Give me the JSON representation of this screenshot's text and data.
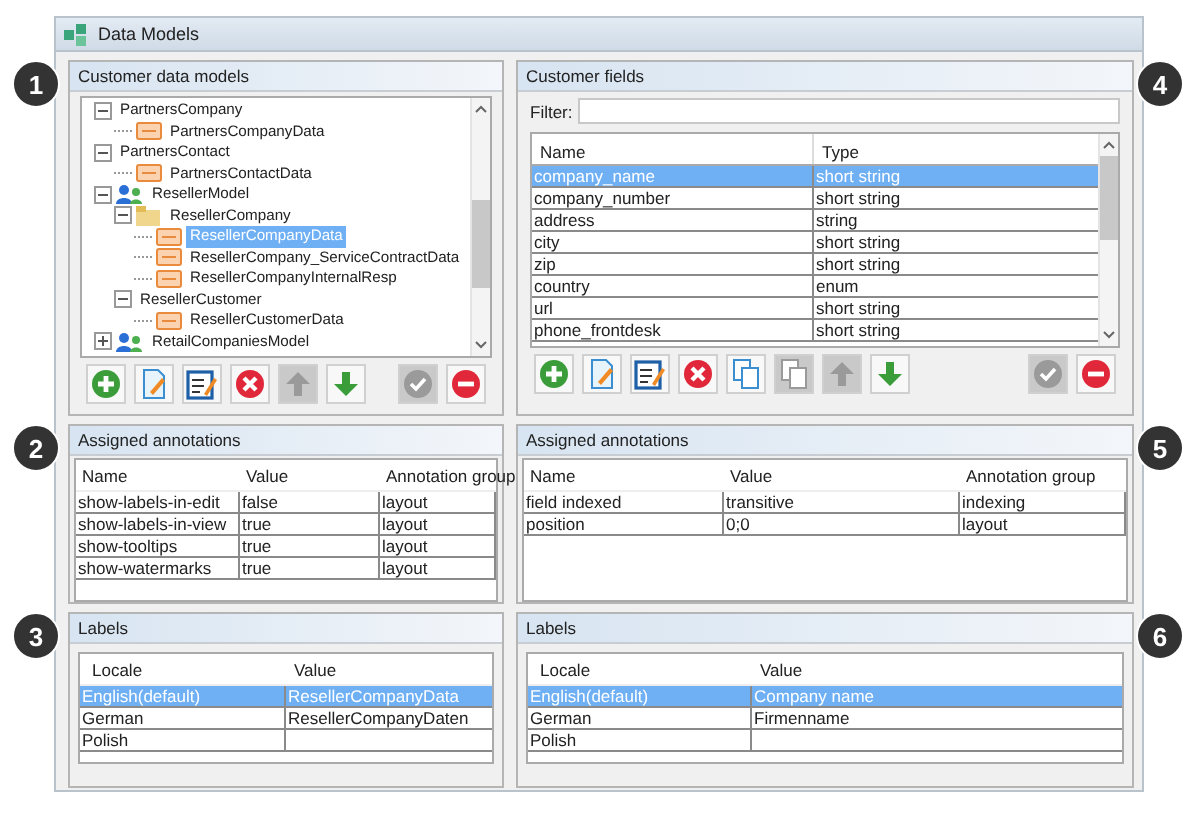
{
  "window": {
    "title": "Data Models"
  },
  "callouts": [
    "1",
    "2",
    "3",
    "4",
    "5",
    "6"
  ],
  "models_panel": {
    "title": "Customer data models",
    "tree": [
      {
        "label": "PartnersCompany",
        "kind": "group",
        "expanded": true,
        "selected": false,
        "children": [
          {
            "label": "PartnersCompanyData",
            "kind": "entity",
            "selected": false
          }
        ]
      },
      {
        "label": "PartnersContact",
        "kind": "group",
        "expanded": true,
        "selected": false,
        "children": [
          {
            "label": "PartnersContactData",
            "kind": "entity",
            "selected": false
          }
        ]
      },
      {
        "label": "ResellerModel",
        "kind": "model",
        "expanded": true,
        "selected": false,
        "children": [
          {
            "label": "ResellerCompany",
            "kind": "folder",
            "expanded": true,
            "selected": false,
            "children": [
              {
                "label": "ResellerCompanyData",
                "kind": "entity",
                "selected": true
              },
              {
                "label": "ResellerCompany_ServiceContractData",
                "kind": "entity",
                "selected": false
              },
              {
                "label": "ResellerCompanyInternalResp",
                "kind": "entity",
                "selected": false
              }
            ]
          },
          {
            "label": "ResellerCustomer",
            "kind": "group",
            "expanded": true,
            "selected": false,
            "children": [
              {
                "label": "ResellerCustomerData",
                "kind": "entity",
                "selected": false
              }
            ]
          }
        ]
      },
      {
        "label": "RetailCompaniesModel",
        "kind": "model",
        "expanded": false,
        "selected": false
      }
    ],
    "toolbar": [
      {
        "kind": "add",
        "disabled": false
      },
      {
        "kind": "edit",
        "disabled": false
      },
      {
        "kind": "properties",
        "disabled": false
      },
      {
        "kind": "delete",
        "disabled": false
      },
      {
        "kind": "up",
        "disabled": true
      },
      {
        "kind": "down",
        "disabled": false
      },
      {
        "kind": "confirm",
        "disabled": true
      },
      {
        "kind": "remove",
        "disabled": false
      }
    ]
  },
  "fields_panel": {
    "title": "Customer fields",
    "filter_label": "Filter:",
    "columns": [
      "Name",
      "Type"
    ],
    "rows": [
      {
        "name": "company_name",
        "type": "short string",
        "selected": true
      },
      {
        "name": "company_number",
        "type": "short string",
        "selected": false
      },
      {
        "name": "address",
        "type": "string",
        "selected": false
      },
      {
        "name": "city",
        "type": "short string",
        "selected": false
      },
      {
        "name": "zip",
        "type": "short string",
        "selected": false
      },
      {
        "name": "country",
        "type": "enum",
        "selected": false
      },
      {
        "name": "url",
        "type": "short string",
        "selected": false
      },
      {
        "name": "phone_frontdesk",
        "type": "short string",
        "selected": false
      }
    ],
    "toolbar": [
      {
        "kind": "add",
        "disabled": false
      },
      {
        "kind": "edit",
        "disabled": false
      },
      {
        "kind": "properties",
        "disabled": false
      },
      {
        "kind": "delete",
        "disabled": false
      },
      {
        "kind": "copy",
        "disabled": false
      },
      {
        "kind": "paste",
        "disabled": true
      },
      {
        "kind": "up",
        "disabled": true
      },
      {
        "kind": "down",
        "disabled": false
      },
      {
        "kind": "confirm",
        "disabled": true
      },
      {
        "kind": "remove",
        "disabled": false
      }
    ]
  },
  "model_annotations": {
    "title": "Assigned annotations",
    "columns": [
      "Name",
      "Value",
      "Annotation group"
    ],
    "rows": [
      [
        "show-labels-in-edit",
        "false",
        "layout"
      ],
      [
        "show-labels-in-view",
        "true",
        "layout"
      ],
      [
        "show-tooltips",
        "true",
        "layout"
      ],
      [
        "show-watermarks",
        "true",
        "layout"
      ]
    ]
  },
  "field_annotations": {
    "title": "Assigned annotations",
    "columns": [
      "Name",
      "Value",
      "Annotation group"
    ],
    "rows": [
      [
        "field indexed",
        "transitive",
        "indexing"
      ],
      [
        "position",
        "0;0",
        "layout"
      ]
    ]
  },
  "model_labels": {
    "title": "Labels",
    "columns": [
      "Locale",
      "Value"
    ],
    "rows": [
      {
        "cells": [
          "English(default)",
          "ResellerCompanyData"
        ],
        "selected": true
      },
      {
        "cells": [
          "German",
          "ResellerCompanyDaten"
        ],
        "selected": false
      },
      {
        "cells": [
          "Polish",
          ""
        ],
        "selected": false
      }
    ]
  },
  "field_labels": {
    "title": "Labels",
    "columns": [
      "Locale",
      "Value"
    ],
    "rows": [
      {
        "cells": [
          "English(default)",
          "Company name"
        ],
        "selected": true
      },
      {
        "cells": [
          "German",
          "Firmenname"
        ],
        "selected": false
      },
      {
        "cells": [
          "Polish",
          ""
        ],
        "selected": false
      }
    ]
  }
}
